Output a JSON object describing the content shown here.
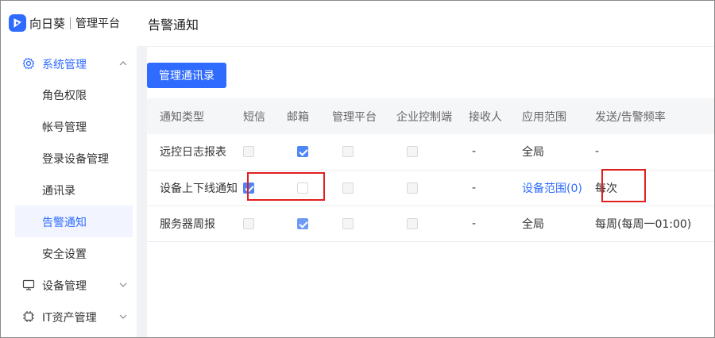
{
  "app": {
    "brand": "向日葵",
    "subtitle": "管理平台"
  },
  "sidebar": {
    "groups": [
      {
        "label": "系统管理",
        "icon": "gear-icon",
        "expanded": true,
        "items": [
          {
            "label": "角色权限"
          },
          {
            "label": "帐号管理"
          },
          {
            "label": "登录设备管理"
          },
          {
            "label": "通讯录"
          },
          {
            "label": "告警通知",
            "active": true
          },
          {
            "label": "安全设置"
          }
        ]
      },
      {
        "label": "设备管理",
        "icon": "monitor-icon",
        "expanded": false
      },
      {
        "label": "IT资产管理",
        "icon": "chip-icon",
        "expanded": false
      }
    ]
  },
  "header": {
    "title": "告警通知"
  },
  "main": {
    "button": "管理通讯录",
    "table": {
      "columns": [
        "通知类型",
        "短信",
        "邮箱",
        "管理平台",
        "企业控制端",
        "接收人",
        "应用范围",
        "发送/告警频率"
      ],
      "rows": [
        {
          "type": "远控日志报表",
          "sms": false,
          "email": true,
          "platform": false,
          "enterprise": false,
          "receiver": "-",
          "scope": "全局",
          "scope_link": false,
          "freq": "-"
        },
        {
          "type": "设备上下线通知",
          "sms": true,
          "email": false,
          "platform": false,
          "enterprise": false,
          "receiver": "-",
          "scope": "设备范围(0)",
          "scope_link": true,
          "freq": "每次"
        },
        {
          "type": "服务器周报",
          "sms": false,
          "email": true,
          "platform": false,
          "enterprise": false,
          "receiver": "-",
          "scope": "全局",
          "scope_link": false,
          "freq": "每周(每周一01:00)"
        }
      ]
    }
  },
  "colors": {
    "accent": "#2f6bff",
    "highlight": "#e02020"
  }
}
